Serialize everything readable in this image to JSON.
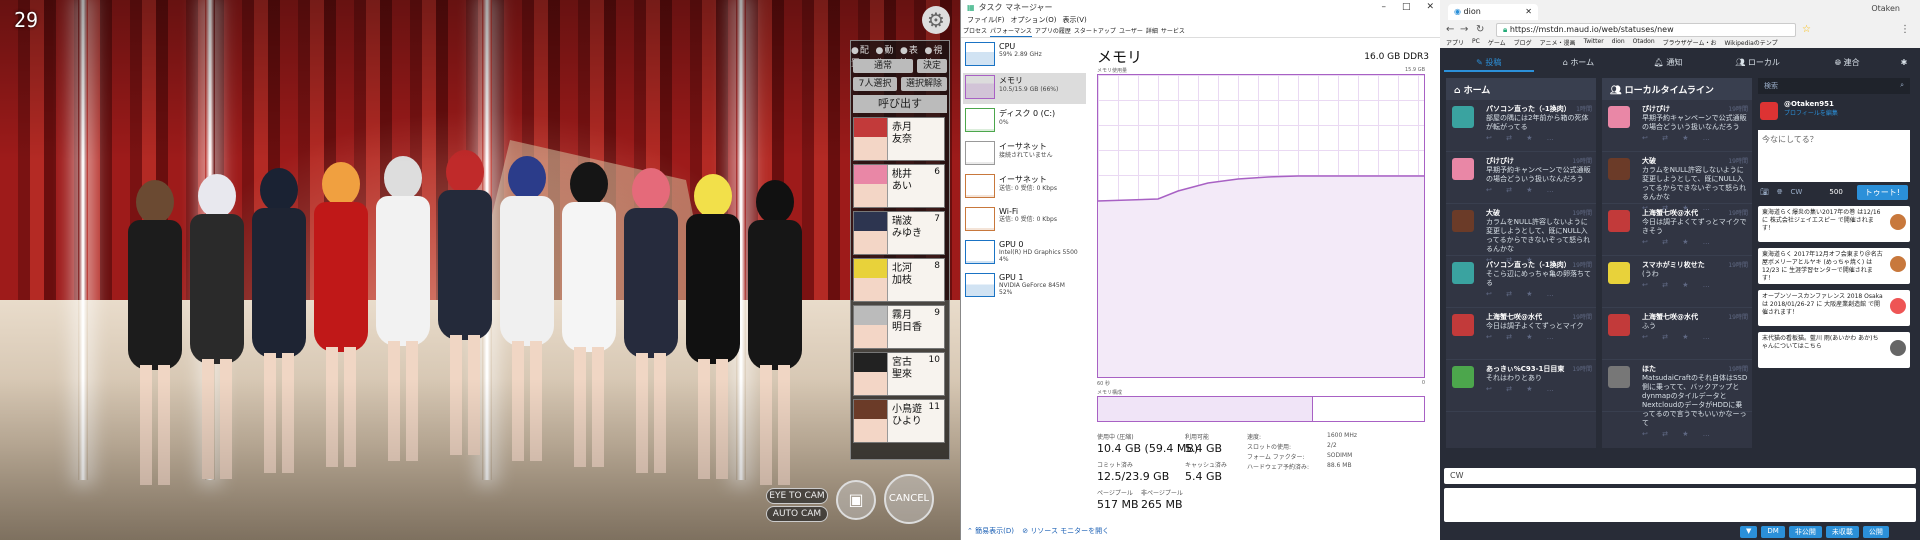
{
  "game": {
    "fps": "29",
    "tabs": [
      "配置",
      "動作",
      "表情",
      "視線"
    ],
    "btn_normal": "通常",
    "btn_decide": "決定",
    "btn_select7": "7人選択",
    "btn_deselect": "選択解除",
    "btn_call": "呼び出す",
    "cards": [
      {
        "num": "",
        "name": "赤月\n友奈",
        "color": "#c23a3a"
      },
      {
        "num": "6",
        "name": "桃井\nあい",
        "color": "#e987a6"
      },
      {
        "num": "7",
        "name": "瑞波\nみゆき",
        "color": "#2d3550"
      },
      {
        "num": "8",
        "name": "北河\n加枝",
        "color": "#e8d23a"
      },
      {
        "num": "9",
        "name": "霧月\n明日香",
        "color": "#bbbbbb"
      },
      {
        "num": "10",
        "name": "宮古\n聖來",
        "color": "#222222"
      },
      {
        "num": "11",
        "name": "小鳥遊\nひより",
        "color": "#6b3b28"
      }
    ],
    "eye_to_cam": "EYE TO CAM",
    "auto_cam": "AUTO CAM",
    "cancel": "CANCEL"
  },
  "taskmgr": {
    "title": "タスク マネージャー",
    "menu": [
      "ファイル(F)",
      "オプション(O)",
      "表示(V)"
    ],
    "tabs": [
      "プロセス",
      "パフォーマンス",
      "アプリの履歴",
      "スタートアップ",
      "ユーザー",
      "詳細",
      "サービス"
    ],
    "items": [
      {
        "name": "CPU",
        "d1": "59% 2.89 GHz",
        "d2": "",
        "color": "#1a73c4"
      },
      {
        "name": "メモリ",
        "d1": "10.5/15.9 GB (66%)",
        "d2": "",
        "color": "#a861c4"
      },
      {
        "name": "ディスク 0 (C:)",
        "d1": "0%",
        "d2": "",
        "color": "#4ca64c"
      },
      {
        "name": "イーサネット",
        "d1": "接続されていません",
        "d2": "",
        "color": "#999999"
      },
      {
        "name": "イーサネット",
        "d1": "送信: 0 受信: 0 Kbps",
        "d2": "",
        "color": "#c8783c"
      },
      {
        "name": "Wi-Fi",
        "d1": "送信: 0 受信: 0 Kbps",
        "d2": "",
        "color": "#c8783c"
      },
      {
        "name": "GPU 0",
        "d1": "Intel(R) HD Graphics 5500",
        "d2": "4%",
        "color": "#1a73c4"
      },
      {
        "name": "GPU 1",
        "d1": "NVIDIA GeForce 845M",
        "d2": "52%",
        "color": "#1a73c4"
      }
    ],
    "main_title": "メモリ",
    "capacity": "16.0 GB DDR3",
    "usage_label": "メモリ使用量",
    "usage_max": "15.9 GB",
    "sec60": "60 秒",
    "zero": "0",
    "comp_label": "メモリ構成",
    "stats": {
      "inuse_l": "使用中 (圧縮)",
      "inuse_v": "10.4 GB (59.4 MB)",
      "avail_l": "利用可能",
      "avail_v": "5.4 GB",
      "commit_l": "コミット済み",
      "commit_v": "12.5/23.9 GB",
      "cache_l": "キャッシュ済み",
      "cache_v": "5.4 GB",
      "paged_l": "ページプール",
      "paged_v": "517 MB",
      "nonpaged_l": "非ページプール",
      "nonpaged_v": "265 MB",
      "speed_l": "速度:",
      "speed_v": "1600 MHz",
      "slots_l": "スロットの使用:",
      "slots_v": "2/2",
      "form_l": "フォーム ファクター:",
      "form_v": "SODIMM",
      "hw_l": "ハードウェア予約済み:",
      "hw_v": "88.6 MB"
    },
    "footer_less": "簡易表示(D)",
    "footer_monitor": "リソース モニターを開く"
  },
  "browser": {
    "tab": "dion",
    "url": "https://mstdn.maud.io/web/statuses/new",
    "profile": "Otaken",
    "bookmarks": [
      "アプリ",
      "PC",
      "ゲーム",
      "ブログ",
      "アニメ・漫画",
      "Twitter",
      "dion",
      "Otadon",
      "ブラウザゲーム・お",
      "Wikipediaのテンプ"
    ],
    "nav": [
      "投稿",
      "ホーム",
      "通知",
      "ローカル",
      "連合"
    ],
    "home_title": "ホーム",
    "local_title": "ローカルタイムライン",
    "home": [
      {
        "who": "パソコン直った（-1換肉）",
        "tm": "1時間",
        "txt": "部屋の隅には2年前から箱の死体が転がってる",
        "c": "#3aa3a0"
      },
      {
        "who": "ぴけぴけ",
        "tm": "19時間",
        "txt": "早期予約キャンペーンで公式通販の場合どういう扱いなんだろう",
        "c": "#e987a6"
      },
      {
        "who": "大破",
        "tm": "19時間",
        "txt": "カラムをNULL許容しないように変更しようとして、既にNULL入ってるからできないぞって怒られるんかな",
        "c": "#6b3b28"
      },
      {
        "who": "パソコン直った（-1換肉）",
        "tm": "19時間",
        "txt": "そこら辺にめっちゃ亀の卵落ちてる",
        "c": "#3aa3a0"
      },
      {
        "who": "上海蟹七咲@水代",
        "tm": "19時間",
        "txt": "今日は調子よくてずっとマイク",
        "c": "#c23a3a"
      },
      {
        "who": "あっきぃ%C93-1日目東",
        "tm": "19時間",
        "txt": "それはわりとあり",
        "c": "#4ca64c"
      }
    ],
    "local": [
      {
        "who": "ぴけぴけ",
        "tm": "19時間",
        "txt": "早期予約キャンペーンで公式通販の場合どういう扱いなんだろう",
        "c": "#e987a6"
      },
      {
        "who": "大破",
        "tm": "19時間",
        "txt": "カラムをNULL許容しないように変更しようとして、既にNULL入ってるからできないぞって怒られるんかな",
        "c": "#6b3b28"
      },
      {
        "who": "上海蟹七咲@水代",
        "tm": "19時間",
        "txt": "今日は調子よくてずっとマイクできそう",
        "c": "#c23a3a"
      },
      {
        "who": "スマホがミリ枚せた",
        "tm": "19時間",
        "txt": "(うわ",
        "c": "#e8d23a"
      },
      {
        "who": "上海蟹七咲@水代",
        "tm": "19時間",
        "txt": "ふう",
        "c": "#c23a3a"
      },
      {
        "who": "ほた",
        "tm": "19時間",
        "txt": "MatsudaiCraftのそれ自体はSSD側に乗ってて、バックアップとdynmapのタイルデータとNextcloudのデータがHDDに乗ってるので言うでもいいかなーって",
        "c": "#777777"
      }
    ],
    "search": "検索",
    "me_name": "@Otaken951",
    "me_link": "プロフィールを編集",
    "compose_ph": "今なにしてる？",
    "cw": "CW",
    "count": "500",
    "toot": "トゥート!",
    "notices": [
      {
        "t": "東海道らく爆炎の集い2017年の巻 は12/16に 株式会社ジェイエスピー で開催されます！",
        "c": "#c8783c"
      },
      {
        "t": "東海道らく 2017年12月オフ会東まり＠名古屋ボメリーアとルヤキ (めっちゃ焼く) は 12/23 に 生涯学習センターで開催されます！",
        "c": "#c8783c"
      },
      {
        "t": "オープンソースカンファレンス 2018 Osaka は 2018/01/26-27 に 大阪産業創造館 で開催されます！",
        "c": "#e55"
      },
      {
        "t": "末代猫の看板猫。藍川 雨(あいかわ あか)ちゃんについてはこちら",
        "c": "#666"
      }
    ],
    "bottom_cw": "CW",
    "bottom_btns": [
      "▼",
      "DM",
      "非公開",
      "未収載",
      "公開"
    ]
  }
}
